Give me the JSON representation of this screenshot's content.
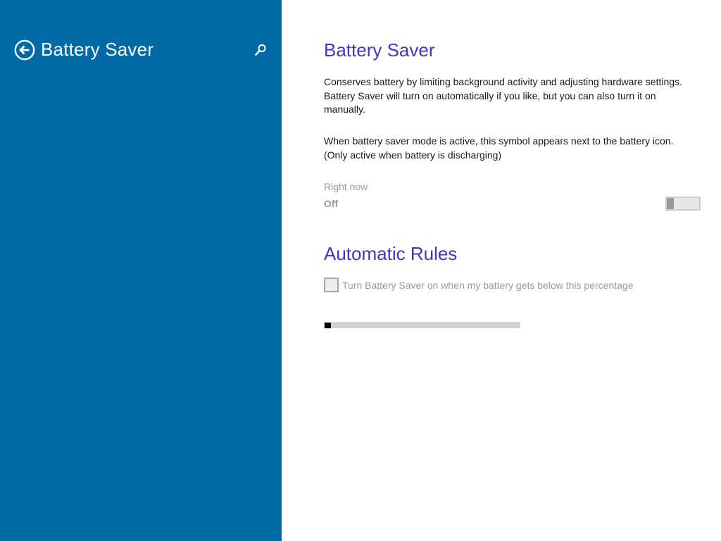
{
  "sidebar": {
    "title": "Battery Saver",
    "back_icon": "back-arrow-circle-icon",
    "search_icon": "search-icon",
    "background": "#006aa7"
  },
  "main": {
    "title": "Battery Saver",
    "description": "Conserves battery by limiting background activity and adjusting hardware settings. Battery Saver will turn on automatically if you like, but you can also turn it on manually.",
    "symbol_note": "When battery saver mode is active, this symbol appears next to the battery icon. (Only active when battery is discharging)",
    "accent_color": "#4b2fc9",
    "toggle": {
      "header": "Right now",
      "state": "Off",
      "on": false,
      "enabled": false
    },
    "automatic_rules": {
      "title": "Automatic Rules",
      "checkbox_label": "Turn Battery Saver on when my battery gets below this percentage",
      "checkbox_checked": false,
      "slider_value": 0
    }
  }
}
